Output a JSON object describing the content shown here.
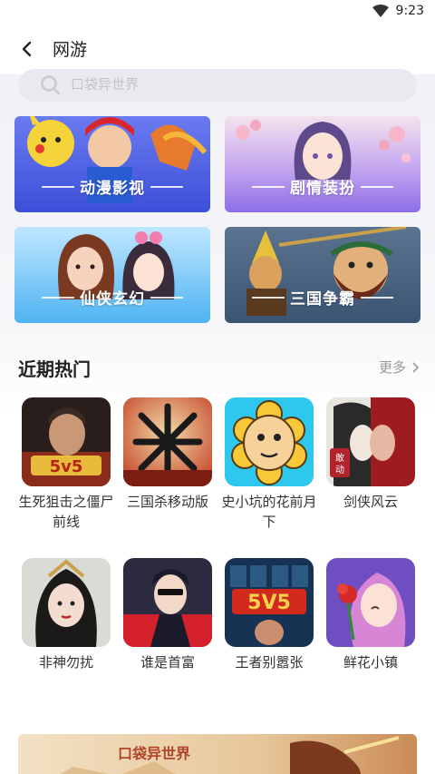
{
  "status_bar": {
    "time": "9:23",
    "wifi_icon": "wifi-icon"
  },
  "app_bar": {
    "title": "网游",
    "back_icon": "back-arrow-icon"
  },
  "search": {
    "placeholder": "口袋异世界",
    "icon": "search-icon"
  },
  "categories": [
    {
      "label": "动漫影视"
    },
    {
      "label": "剧情装扮"
    },
    {
      "label": "仙侠玄幻"
    },
    {
      "label": "三国争霸"
    }
  ],
  "hot_section": {
    "title": "近期热门",
    "more_label": "更多",
    "more_icon": "chevron-right-icon"
  },
  "games": [
    {
      "name": "生死狙击之僵尸前线"
    },
    {
      "name": "三国杀移动版"
    },
    {
      "name": "史小坑的花前月下"
    },
    {
      "name": "剑侠风云"
    },
    {
      "name": "非神勿扰"
    },
    {
      "name": "谁是首富"
    },
    {
      "name": "王者别嚣张"
    },
    {
      "name": "鲜花小镇"
    }
  ],
  "banner": {
    "logo_text": "口袋异世界"
  }
}
